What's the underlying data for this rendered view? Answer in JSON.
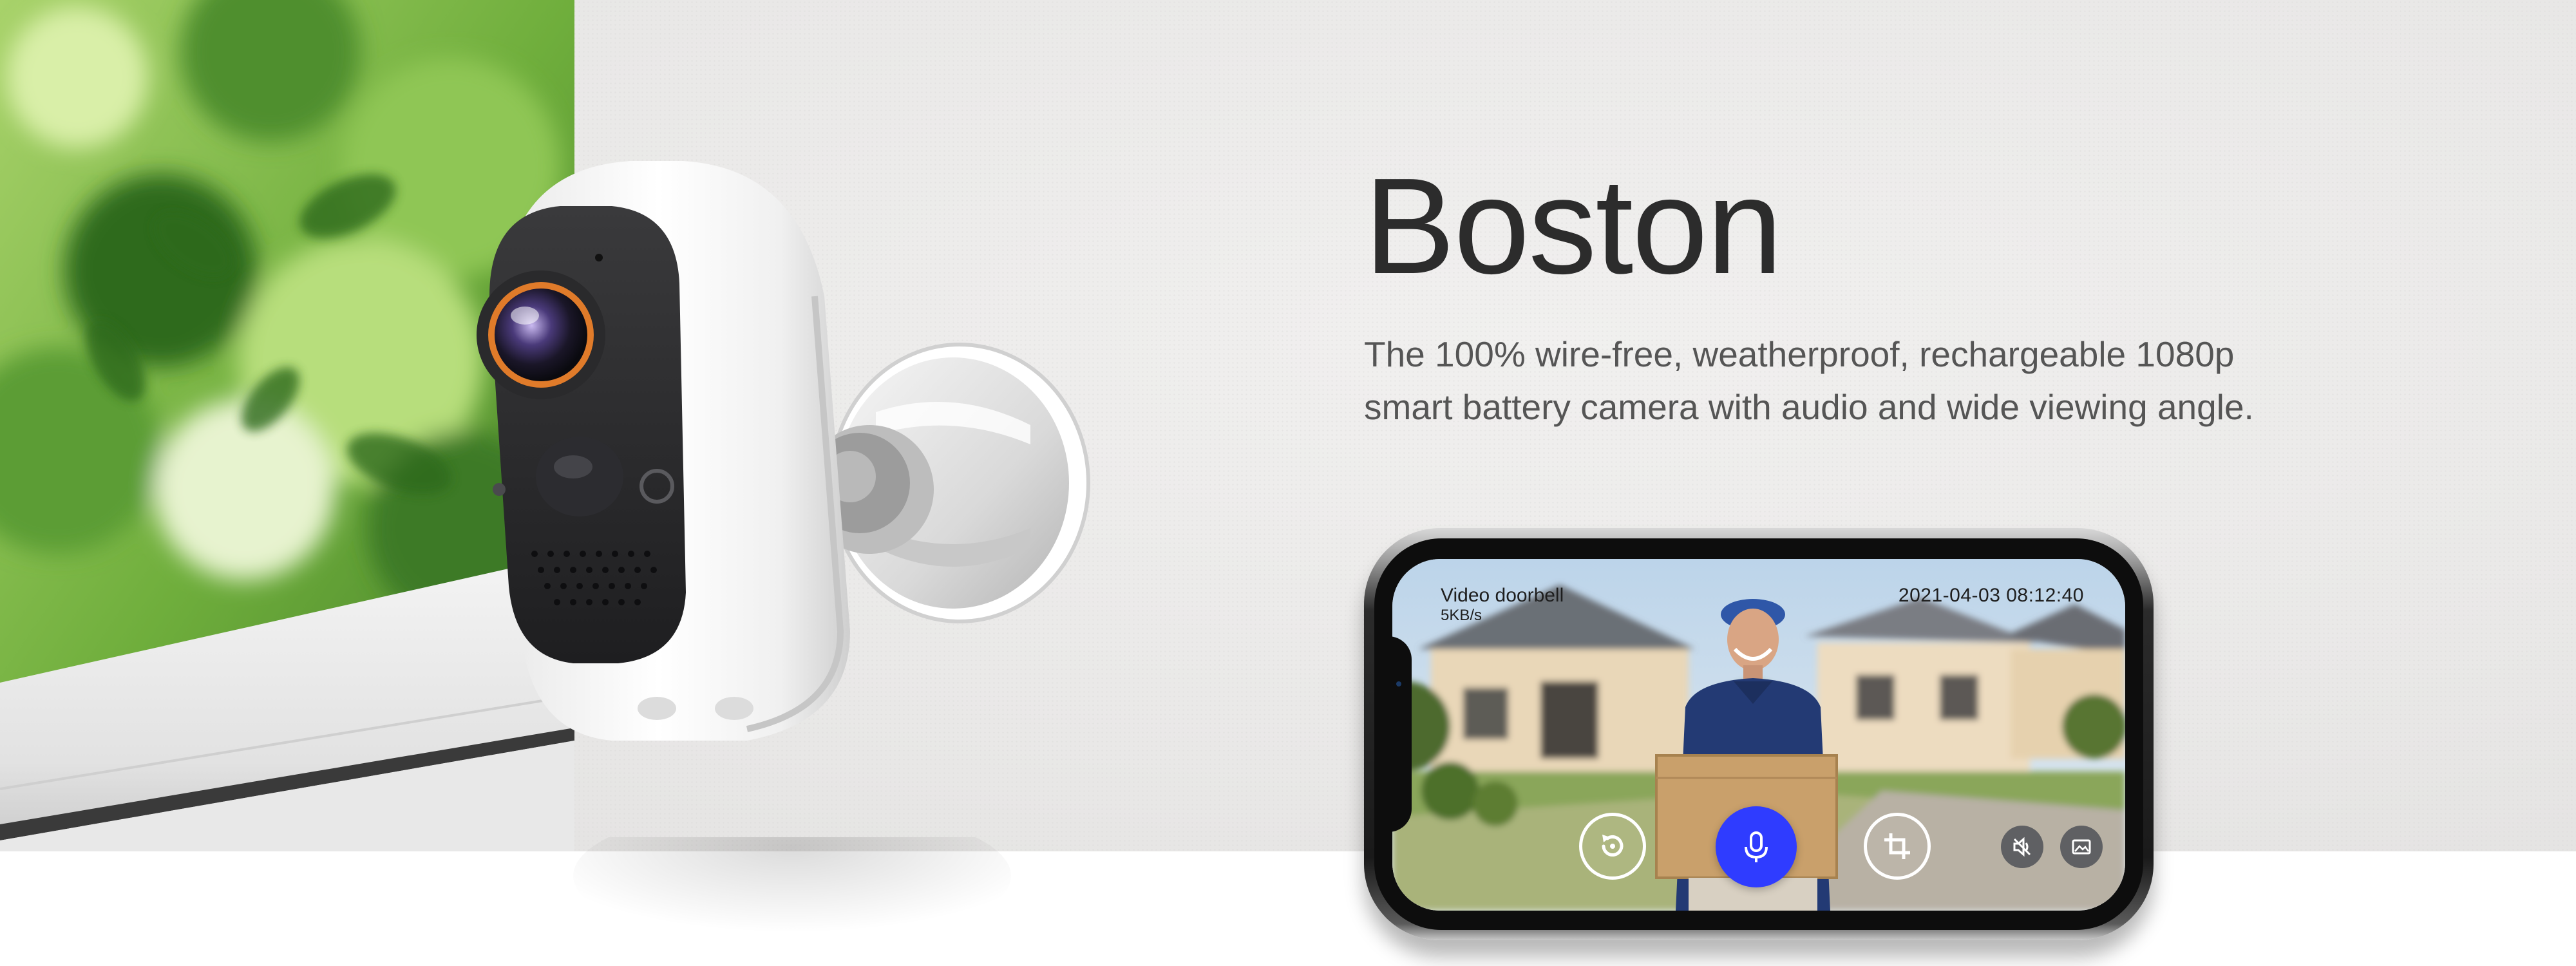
{
  "product": {
    "name": "Boston",
    "description_lines": [
      "The 100% wire-free, weatherproof, rechargeable 1080p",
      "smart battery camera with audio and wide viewing angle."
    ]
  },
  "phone_app": {
    "feed_title": "Video doorbell",
    "data_rate": "5KB/s",
    "timestamp": "2021-04-03  08:12:40",
    "controls": {
      "replay": "replay-icon",
      "microphone": "microphone-icon",
      "crop": "crop-icon",
      "mute": "mute-icon",
      "screenshot": "screenshot-icon"
    }
  },
  "colors": {
    "mic_button": "#2f3cff",
    "title_text": "#2c2c2c",
    "wall": "#ebeae9",
    "floor": "#ffffff"
  }
}
